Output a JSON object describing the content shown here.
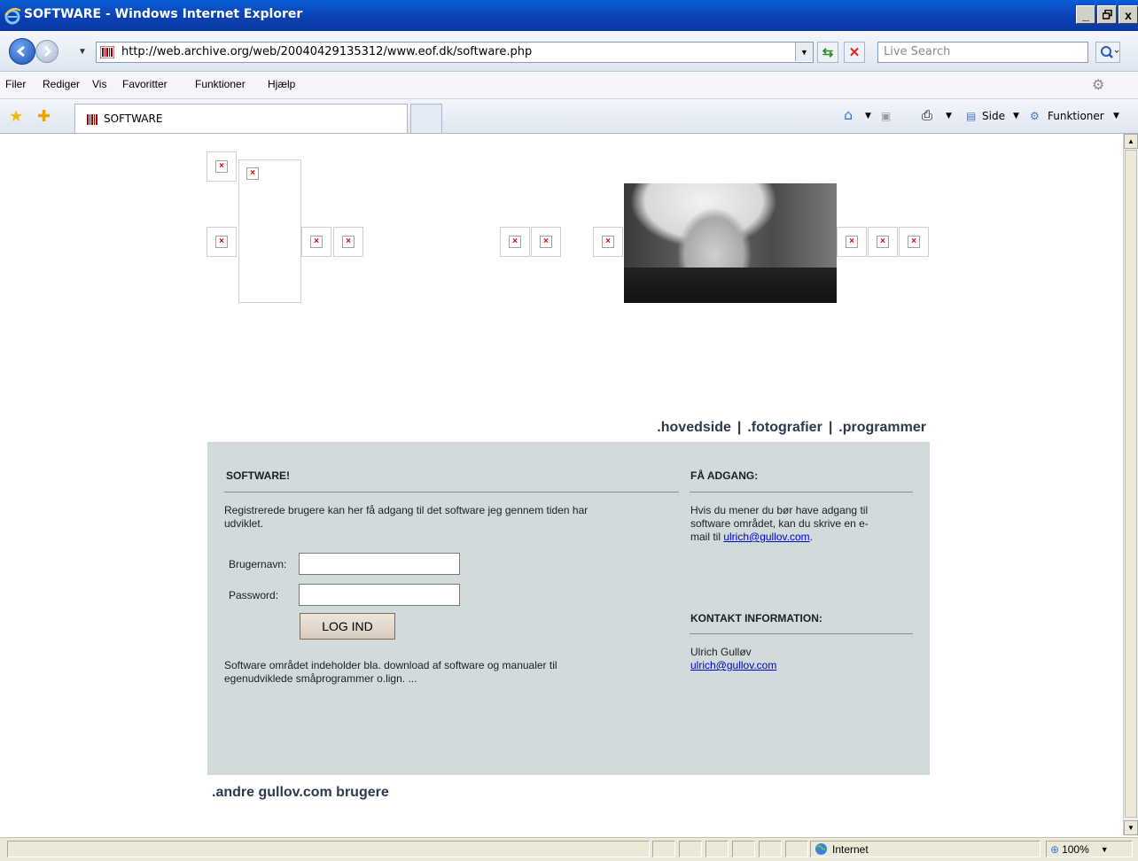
{
  "window": {
    "title": "SOFTWARE - Windows Internet Explorer",
    "controls": [
      "_",
      "ǿ",
      "x"
    ]
  },
  "address_bar": {
    "url": "http://web.archive.org/web/20040429135312/www.eof.dk/software.php",
    "search_placeholder": "Live Search"
  },
  "menu": {
    "items": [
      "Filer",
      "Rediger",
      "Vis",
      "Favoritter",
      "Funktioner",
      "Hjælp"
    ]
  },
  "tabs": {
    "active_label": "SOFTWARE"
  },
  "command_bar": {
    "side_label": "Side",
    "tools_label": "Funktioner"
  },
  "page": {
    "nav": {
      "home": ".hovedside",
      "photos": ".fotografier",
      "programs": ".programmer",
      "sep": "|"
    },
    "software": {
      "heading": "SOFTWARE!",
      "intro_line1": "Registrerede brugere kan her få adgang til det software jeg gennem tiden har",
      "intro_line2": "udviklet.",
      "username_label": "Brugernavn:",
      "password_label": "Password:",
      "username_value": "",
      "password_value": "",
      "login_button": "LOG IND",
      "info_line1": "Software området indeholder bla. download af software og manualer til",
      "info_line2": "egenudviklede småprogrammer o.lign. ..."
    },
    "access": {
      "heading": "FÅ ADGANG:",
      "line1": "Hvis du mener du bør have adgang til",
      "line2": "software området, kan du skrive en e-",
      "line3_prefix": "mail til ",
      "email": "ulrich@gullov.com",
      "line3_suffix": "."
    },
    "contact": {
      "heading": "KONTAKT INFORMATION:",
      "name": "Ulrich Gulløv",
      "email": "ulrich@gullov.com"
    },
    "footer_link": ".andre gullov.com brugere"
  },
  "status_bar": {
    "zone": "Internet",
    "zoom": "100%"
  },
  "colors": {
    "panel_bg": "#d1dbdb",
    "nav_text": "#2b3a4f",
    "link": "#0000cc"
  }
}
